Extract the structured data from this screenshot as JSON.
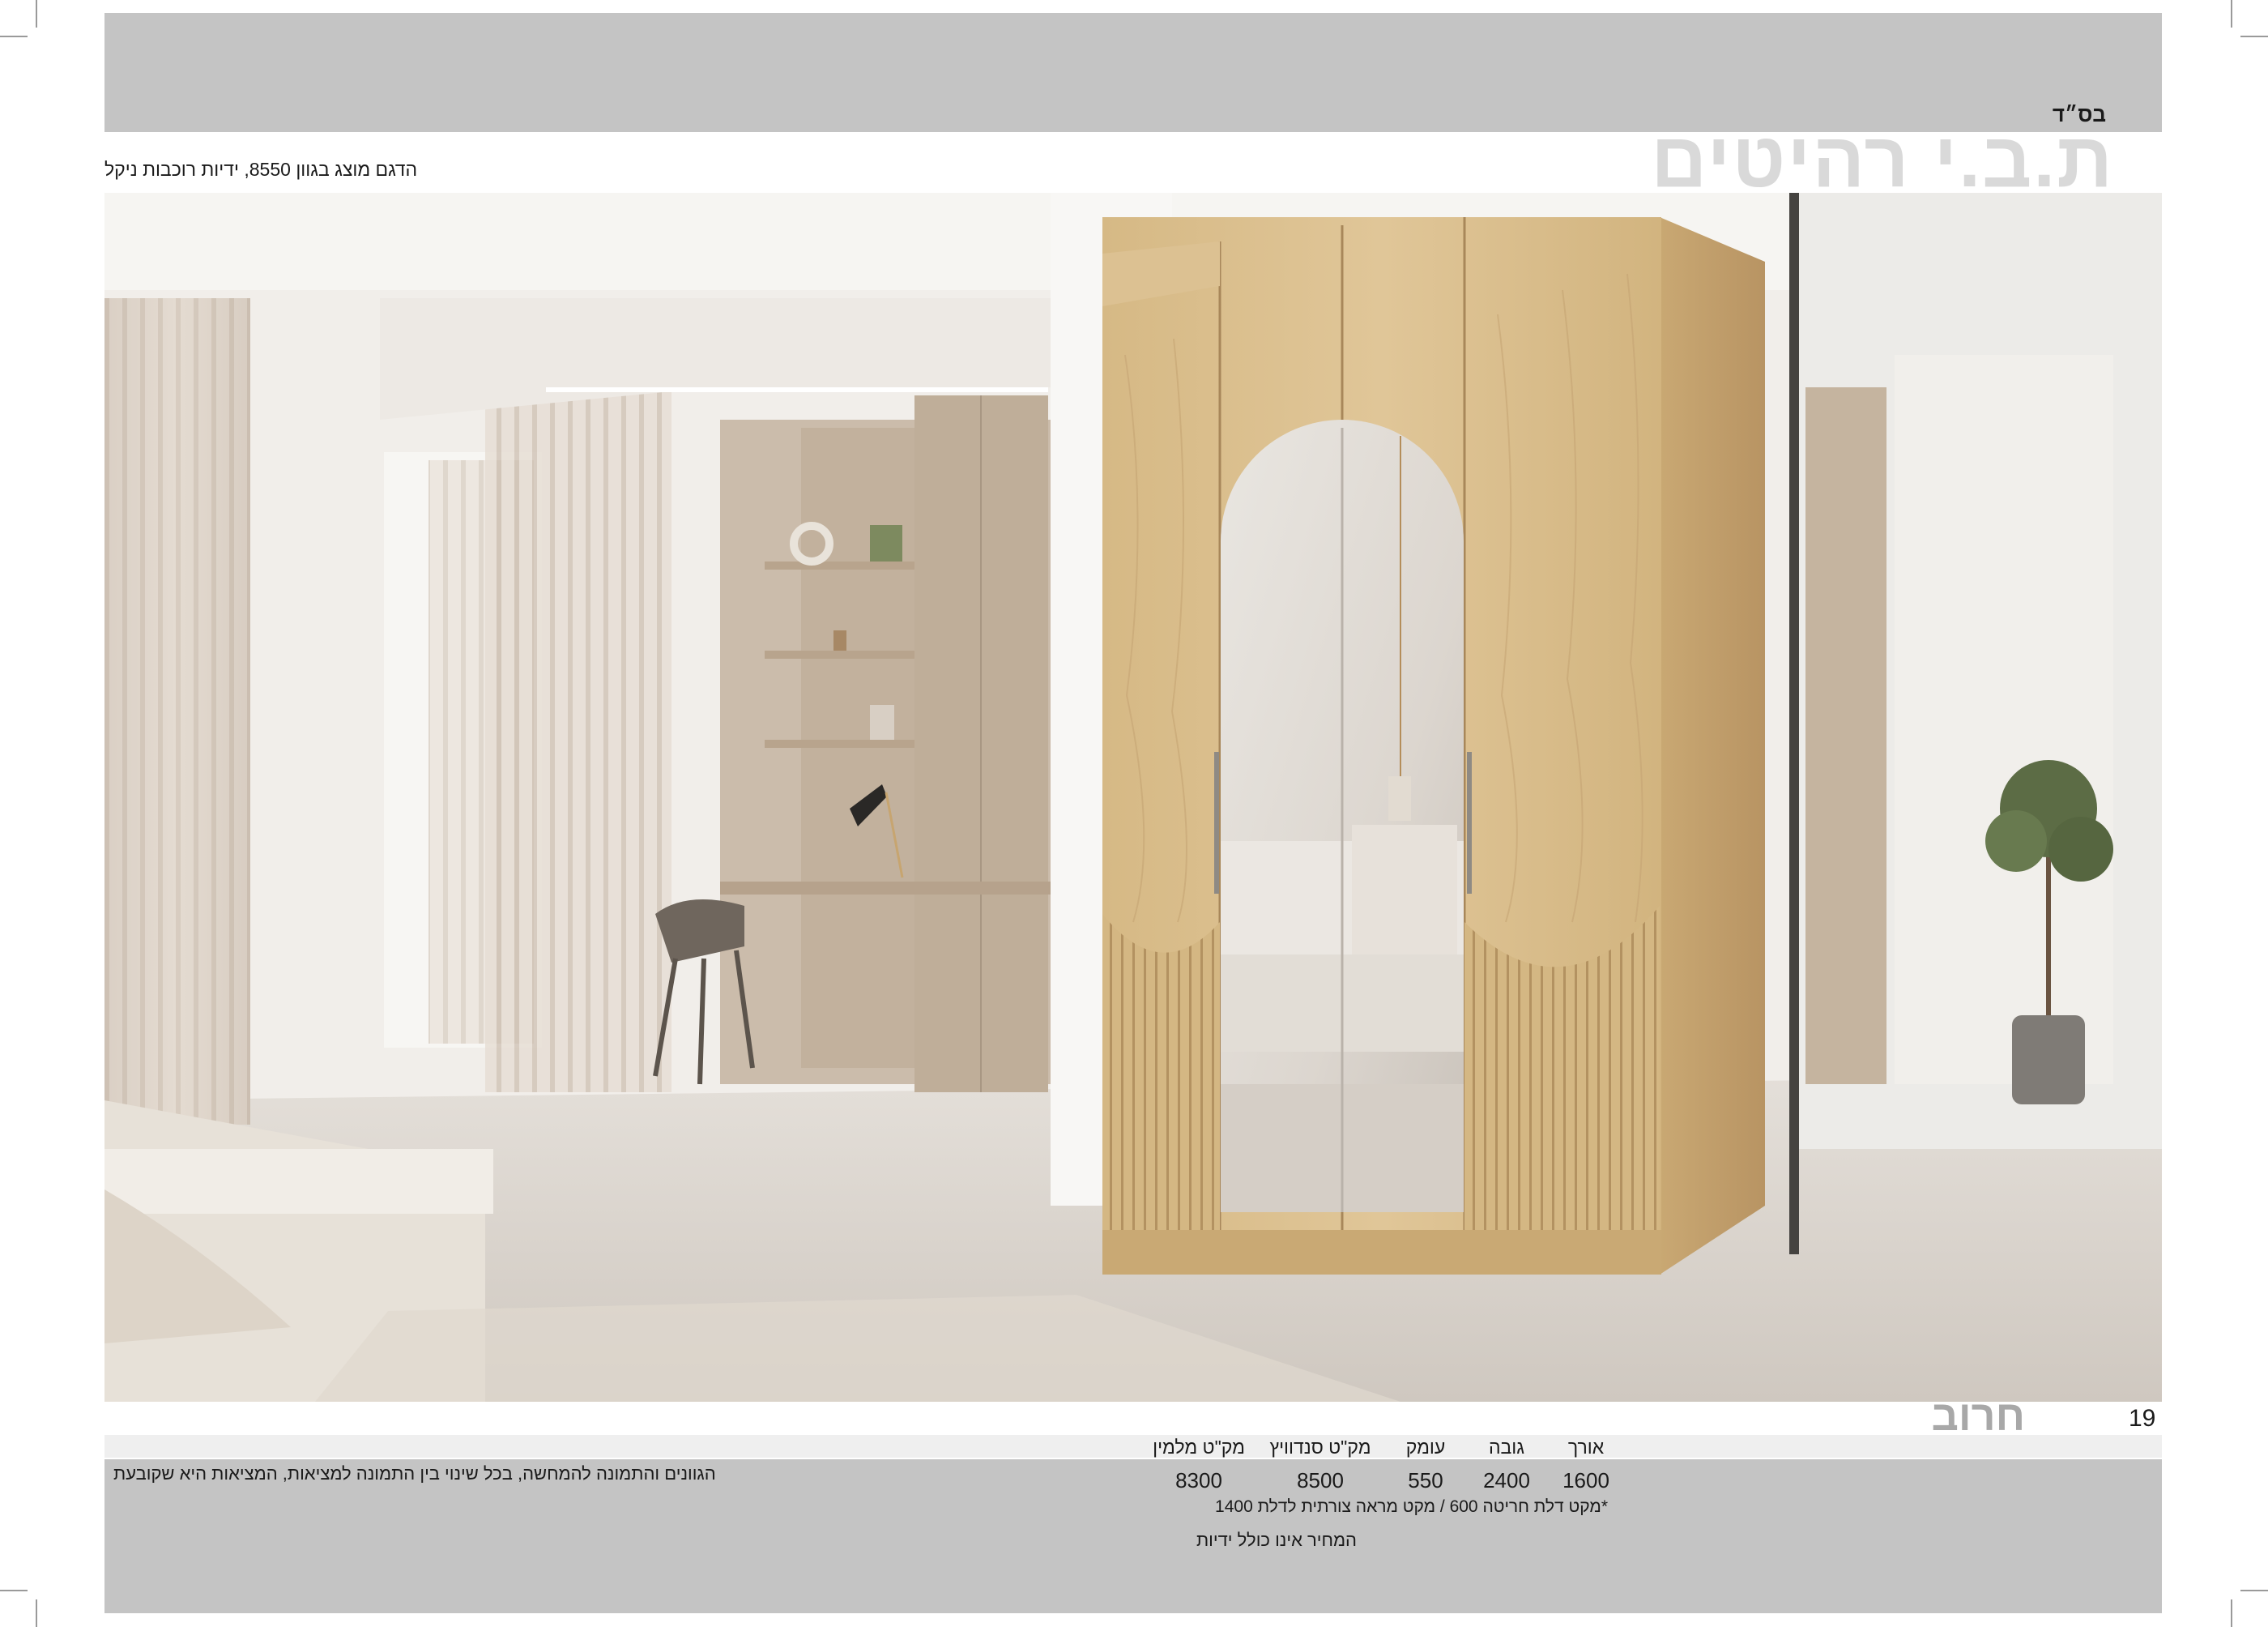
{
  "header": {
    "bsd": "בס״ד",
    "brand": "ת.ב.י רהיטים",
    "model_note": "הדגם מוצג בגוון 8550, ידיות רוכבות ניקל"
  },
  "page": {
    "number": "19",
    "product_name": "חרוב"
  },
  "specs": {
    "columns": [
      {
        "label": "אורך",
        "value": "1600"
      },
      {
        "label": "גובה",
        "value": "2400"
      },
      {
        "label": "עומק",
        "value": "550"
      },
      {
        "label": "מק\"ט סנדוויץ",
        "value": "8500"
      },
      {
        "label": "מק\"ט מלמין",
        "value": "8300"
      }
    ],
    "door_note": "*מקט דלת חריטה 600 / מקט מראה צורתית לדלת 1400",
    "price_note": "המחיר אינו כולל ידיות"
  },
  "disclaimer": "הגוונים והתמונה להמחשה, בכל שינוי בין התמונה למציאות, המציאות היא שקובעת",
  "colors": {
    "band_gray": "#c4c4c4",
    "brand_gray": "#d9d9d9",
    "wood": "#d8bc8a",
    "wall": "#f3f1ee",
    "floor": "#d9d3cc"
  },
  "photo": {
    "subject": "wardrobe-with-arched-mirror"
  }
}
